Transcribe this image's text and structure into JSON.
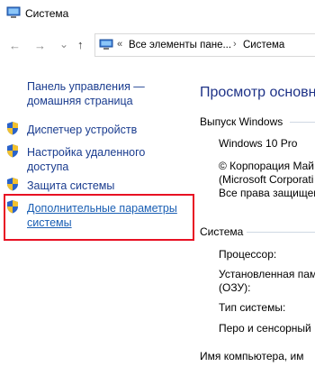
{
  "window": {
    "title": "Система"
  },
  "nav": {
    "back_glyph": "←",
    "forward_glyph": "→",
    "recent_glyph": "⌄",
    "up_glyph": "↑",
    "breadcrumb_prefix": "«",
    "breadcrumb": [
      "Все элементы пане...",
      "Система"
    ],
    "separator": "›"
  },
  "sidebar": {
    "home_label_line1": "Панель управления —",
    "home_label_line2": "домашняя страница",
    "items": [
      {
        "label": "Диспетчер устройств"
      },
      {
        "label_line1": "Настройка удаленного",
        "label_line2": "доступа"
      },
      {
        "label": "Защита системы"
      },
      {
        "label_line1": "Дополнительные параметры",
        "label_line2": "системы"
      }
    ]
  },
  "main": {
    "heading": "Просмотр основн",
    "windows_edition": {
      "title": "Выпуск Windows",
      "edition": "Windows 10 Pro",
      "copyright_line1": "© Корпорация Май",
      "copyright_line2": "(Microsoft Corporati",
      "copyright_line3": "Все права защищен"
    },
    "system": {
      "title": "Система",
      "processor": "Процессор:",
      "ram_line1": "Установленная пам",
      "ram_line2": "(ОЗУ):",
      "system_type": "Тип системы:",
      "pen_touch": "Перо и сенсорный"
    },
    "computer_name_cut": "Имя компьютера, им"
  },
  "colors": {
    "link": "#1a3c8f",
    "heading": "#1e3287",
    "highlight": "#e81123"
  }
}
